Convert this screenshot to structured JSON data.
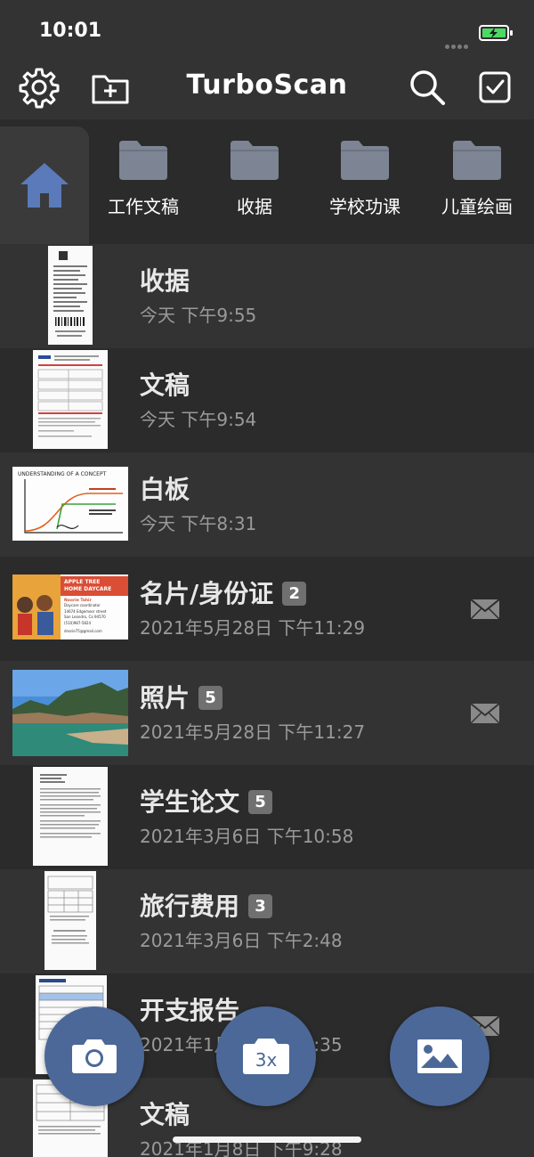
{
  "status": {
    "time": "10:01"
  },
  "nav": {
    "title": "TurboScan",
    "settings_icon": "gear-icon",
    "new_folder_icon": "folder-plus-icon",
    "search_icon": "search-icon",
    "select_icon": "checkbox-icon"
  },
  "folders": [
    {
      "label": "工作文稿"
    },
    {
      "label": "收据"
    },
    {
      "label": "学校功课"
    },
    {
      "label": "儿童绘画"
    }
  ],
  "documents": [
    {
      "title": "收据",
      "badge": "",
      "date": "今天 下午9:55",
      "mail": false
    },
    {
      "title": "文稿",
      "badge": "",
      "date": "今天 下午9:54",
      "mail": false
    },
    {
      "title": "白板",
      "badge": "",
      "date": "今天 下午8:31",
      "mail": false
    },
    {
      "title": "名片/身份证",
      "badge": "2",
      "date": "2021年5月28日 下午11:29",
      "mail": true
    },
    {
      "title": "照片",
      "badge": "5",
      "date": "2021年5月28日 下午11:27",
      "mail": true
    },
    {
      "title": "学生论文",
      "badge": "5",
      "date": "2021年3月6日 下午10:58",
      "mail": false
    },
    {
      "title": "旅行费用",
      "badge": "3",
      "date": "2021年3月6日 下午2:48",
      "mail": false
    },
    {
      "title": "开支报告",
      "badge": "",
      "date": "2021年1月8日 下午1:35",
      "mail": true
    },
    {
      "title": "文稿",
      "badge": "",
      "date": "2021年1月8日 下午9:28",
      "mail": false
    }
  ],
  "thumbnails": {
    "whiteboard_text": "UNDERSTANDING OF A CONCEPT",
    "business_card": {
      "line1": "APPLE TREE",
      "line2": "HOME DAYCARE",
      "name": "Noorie Tahir",
      "role": "Daycare coordinator",
      "address": "14674 Edgemoor street",
      "city": "San Leandro, Ca 94570",
      "phone": "(510)987-5824",
      "email": "dnorie75@gmail.com"
    }
  },
  "actions": {
    "camera": "camera-icon",
    "batch": "3x",
    "gallery": "image-icon"
  },
  "colors": {
    "accent": "#4b6898",
    "background": "#2b2b2b",
    "row_alt": "#333333",
    "battery": "#4cd964"
  }
}
